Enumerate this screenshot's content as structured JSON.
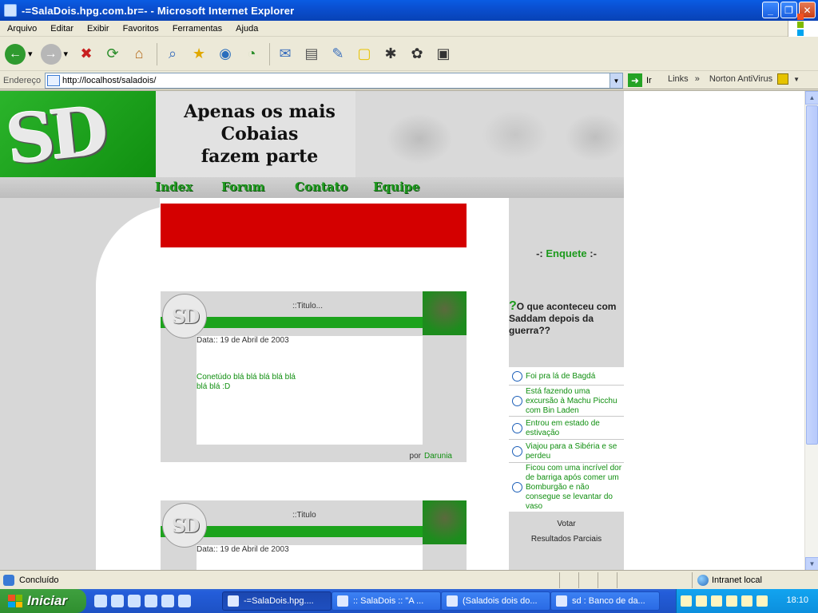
{
  "window": {
    "title": "-=SalaDois.hpg.com.br=- - Microsoft Internet Explorer"
  },
  "menu": [
    "Arquivo",
    "Editar",
    "Exibir",
    "Favoritos",
    "Ferramentas",
    "Ajuda"
  ],
  "address": {
    "label": "Endereço",
    "url": "http://localhost/saladois/",
    "go_label": "Ir",
    "links_label": "Links",
    "norton_label": "Norton AntiVirus"
  },
  "site": {
    "logo": "SD",
    "slogan": [
      "Apenas os mais",
      "Cobaias",
      "fazem parte"
    ],
    "nav": [
      "Index",
      "Forum",
      "Contato",
      "Equipe"
    ]
  },
  "posts": [
    {
      "title": "::Titulo...",
      "date": "Data:: 19 de Abril de 2003",
      "content": "Conetúdo blá blá blá blá blá blá blá :D",
      "by": "por",
      "author": "Darunia"
    },
    {
      "title": "::Titulo",
      "date": "Data:: 19 de Abril de 2003"
    }
  ],
  "poll": {
    "title_prefix": "-: ",
    "title": "Enquete",
    "title_suffix": " :-",
    "question": "O que aconteceu com Saddam depois da guerra??",
    "options": [
      "Foi pra lá de Bagdá",
      "Está fazendo uma excursão à Machu Picchu com Bin Laden",
      "Entrou em estado de estivação",
      "Viajou para a Sibéria e se perdeu",
      "Ficou com uma incrível dor de barriga após comer um Bomburgão e não consegue se levantar do vaso"
    ],
    "vote_label": "Votar",
    "results_label": "Resultados Parciais"
  },
  "status": {
    "text": "Concluído",
    "zone": "Intranet local"
  },
  "taskbar": {
    "start": "Iniciar",
    "tasks": [
      "-=SalaDois.hpg....",
      ":: SalaDois :: \"A ...",
      "(Saladois dois do...",
      "sd : Banco de da..."
    ],
    "clock": "18:10"
  }
}
